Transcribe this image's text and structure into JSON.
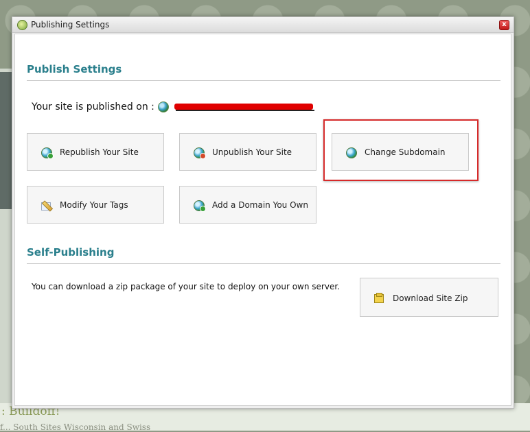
{
  "dialog": {
    "title": "Publishing Settings",
    "close_glyph": "x"
  },
  "publish": {
    "heading": "Publish Settings",
    "published_on_label": "Your site is published on :",
    "buttons": {
      "republish": "Republish Your Site",
      "unpublish": "Unpublish Your Site",
      "change_subdomain": "Change Subdomain",
      "modify_tags": "Modify Your Tags",
      "add_domain": "Add a Domain You Own"
    }
  },
  "self_publishing": {
    "heading": "Self-Publishing",
    "description": "You can download a zip package of your site to deploy on your own server.",
    "download_button": "Download Site Zip"
  },
  "background": {
    "page_title": ": Buildoff!",
    "page_subtitle": "f... South Sites Wisconsin and Swiss"
  },
  "colors": {
    "heading": "#2a7f8c",
    "highlight": "#d62a2a",
    "redaction": "#e00000"
  },
  "icons": {
    "title": "globe-icon",
    "published": "globe-icon",
    "republish": "globe-refresh-icon",
    "unpublish": "globe-remove-icon",
    "change_subdomain": "globe-edit-icon",
    "modify_tags": "tag-edit-icon",
    "add_domain": "globe-add-icon",
    "download": "zip-package-icon"
  }
}
